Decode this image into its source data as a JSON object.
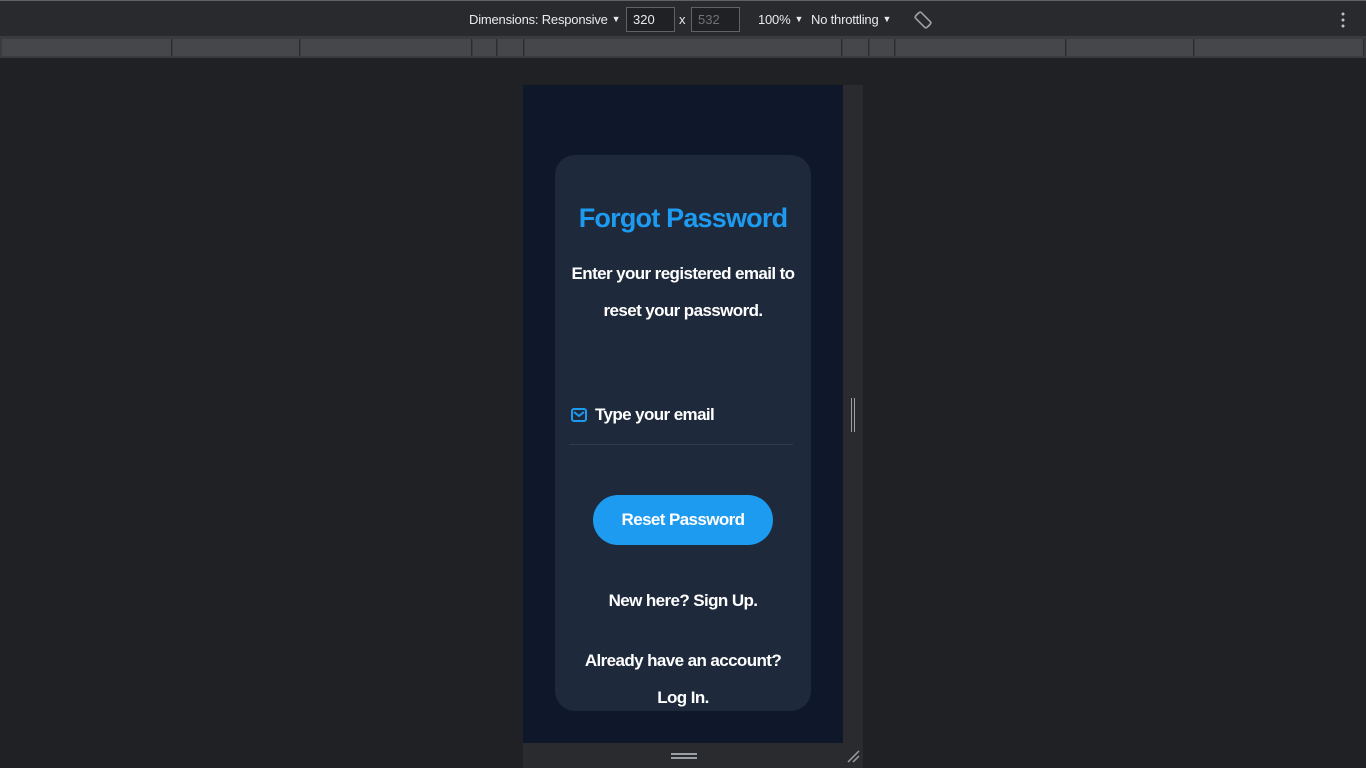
{
  "devtools": {
    "dimensions_label": "Dimensions: Responsive",
    "width_value": "320",
    "times": "x",
    "height_placeholder": "532",
    "zoom": "100%",
    "throttling": "No throttling",
    "caret": "▼",
    "rotate_icon": "rotate-icon",
    "more_icon": "kebab-menu-icon"
  },
  "page": {
    "title": "Forgot Password",
    "subtitle": "Enter your registered email to reset your password.",
    "email_placeholder": "Type your email",
    "email_icon": "mail-icon",
    "reset_button": "Reset Password",
    "signup_link": "New here? Sign Up.",
    "login_link": "Already have an account? Log In."
  },
  "colors": {
    "accent": "#1d9bf0",
    "page_bg": "#0f172a",
    "card_bg": "#1e293b",
    "text": "#ffffff"
  }
}
